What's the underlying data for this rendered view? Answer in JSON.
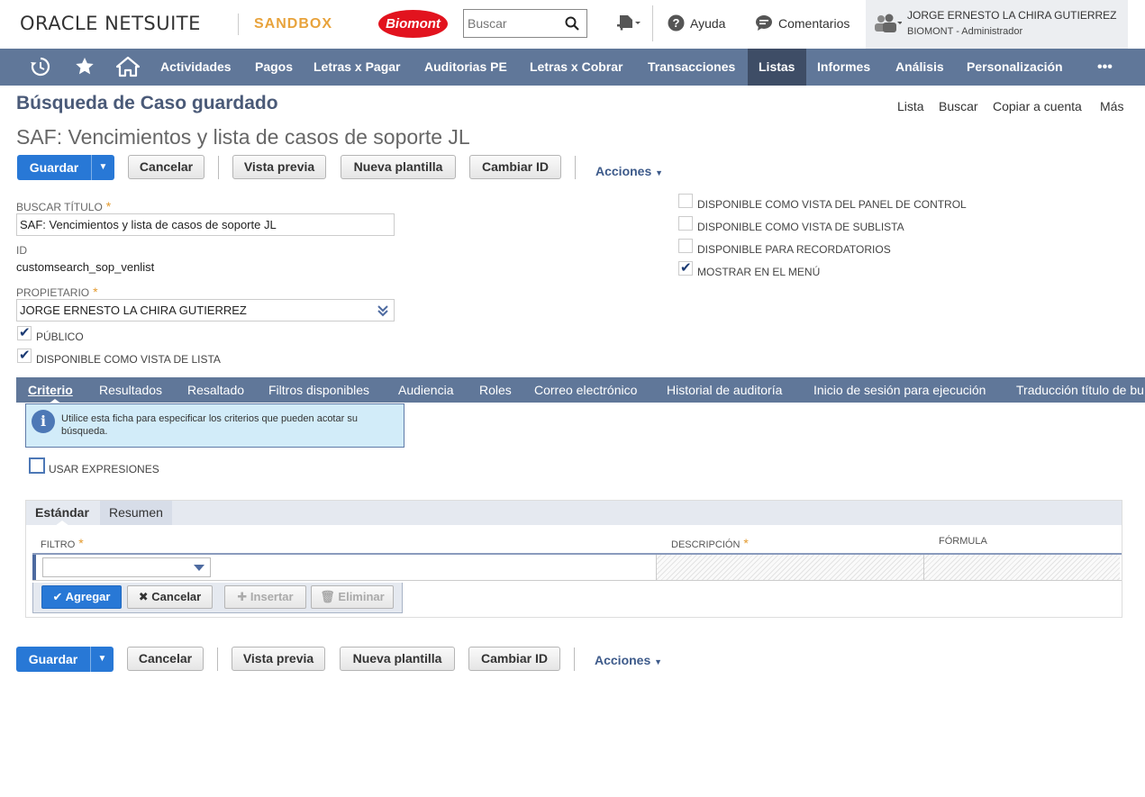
{
  "header": {
    "oracle_prefix": "ORACLE",
    "netsuite": "NETSUITE",
    "environment": "SANDBOX",
    "company_logo": "Biomont",
    "search_placeholder": "Buscar",
    "help": "Ayuda",
    "feedback": "Comentarios",
    "user_name": "JORGE ERNESTO LA CHIRA GUTIERREZ",
    "user_role": "BIOMONT - Administrador"
  },
  "nav": {
    "items": [
      "Actividades",
      "Pagos",
      "Letras x Pagar",
      "Auditorias PE",
      "Letras x Cobrar",
      "Transacciones",
      "Listas",
      "Informes",
      "Análisis",
      "Personalización"
    ],
    "active": "Listas",
    "more": "•••"
  },
  "page": {
    "title": "Búsqueda de Caso guardado",
    "subtitle": "SAF: Vencimientos y lista de casos de soporte JL",
    "links": [
      "Lista",
      "Buscar",
      "Copiar a cuenta",
      "Más"
    ]
  },
  "buttons": {
    "save": "Guardar",
    "cancel": "Cancelar",
    "preview": "Vista previa",
    "new_template": "Nueva plantilla",
    "change_id": "Cambiar ID",
    "actions": "Acciones"
  },
  "form": {
    "search_title_label": "BUSCAR TÍTULO",
    "search_title_value": "SAF: Vencimientos y lista de casos de soporte JL",
    "id_label": "ID",
    "id_value": "customsearch_sop_venlist",
    "owner_label": "PROPIETARIO",
    "owner_value": "JORGE ERNESTO LA CHIRA GUTIERREZ",
    "public_label": "PÚBLICO",
    "public_checked": true,
    "list_view_label": "DISPONIBLE COMO VISTA DE LISTA",
    "list_view_checked": true,
    "dashboard_label": "DISPONIBLE COMO VISTA DEL PANEL DE CONTROL",
    "dashboard_checked": false,
    "sublist_label": "DISPONIBLE COMO VISTA DE SUBLISTA",
    "sublist_checked": false,
    "reminders_label": "DISPONIBLE PARA RECORDATORIOS",
    "reminders_checked": false,
    "menu_label": "MOSTRAR EN EL MENÚ",
    "menu_checked": true
  },
  "subtabs": {
    "items": [
      "Criterio",
      "Resultados",
      "Resaltado",
      "Filtros disponibles",
      "Audiencia",
      "Roles",
      "Correo electrónico",
      "Historial de auditoría",
      "Inicio de sesión para ejecución",
      "Traducción título de bu"
    ],
    "active": "Criterio"
  },
  "criteria": {
    "info": "Utilice esta ficha para especificar los criterios que pueden acotar su búsqueda.",
    "use_expressions": "USAR EXPRESIONES",
    "tabs": [
      "Estándar",
      "Resumen"
    ],
    "active_tab": "Estándar",
    "columns": [
      "FILTRO",
      "DESCRIPCIÓN",
      "FÓRMULA"
    ],
    "add": "Agregar",
    "cancel": "Cancelar",
    "insert": "Insertar",
    "remove": "Eliminar"
  },
  "colors": {
    "nav_bg": "#607799",
    "nav_active": "#3e4d66",
    "primary": "#2878d6",
    "title": "#4a5a78",
    "sandbox": "#e8a33c",
    "required": "#e39a2f"
  }
}
